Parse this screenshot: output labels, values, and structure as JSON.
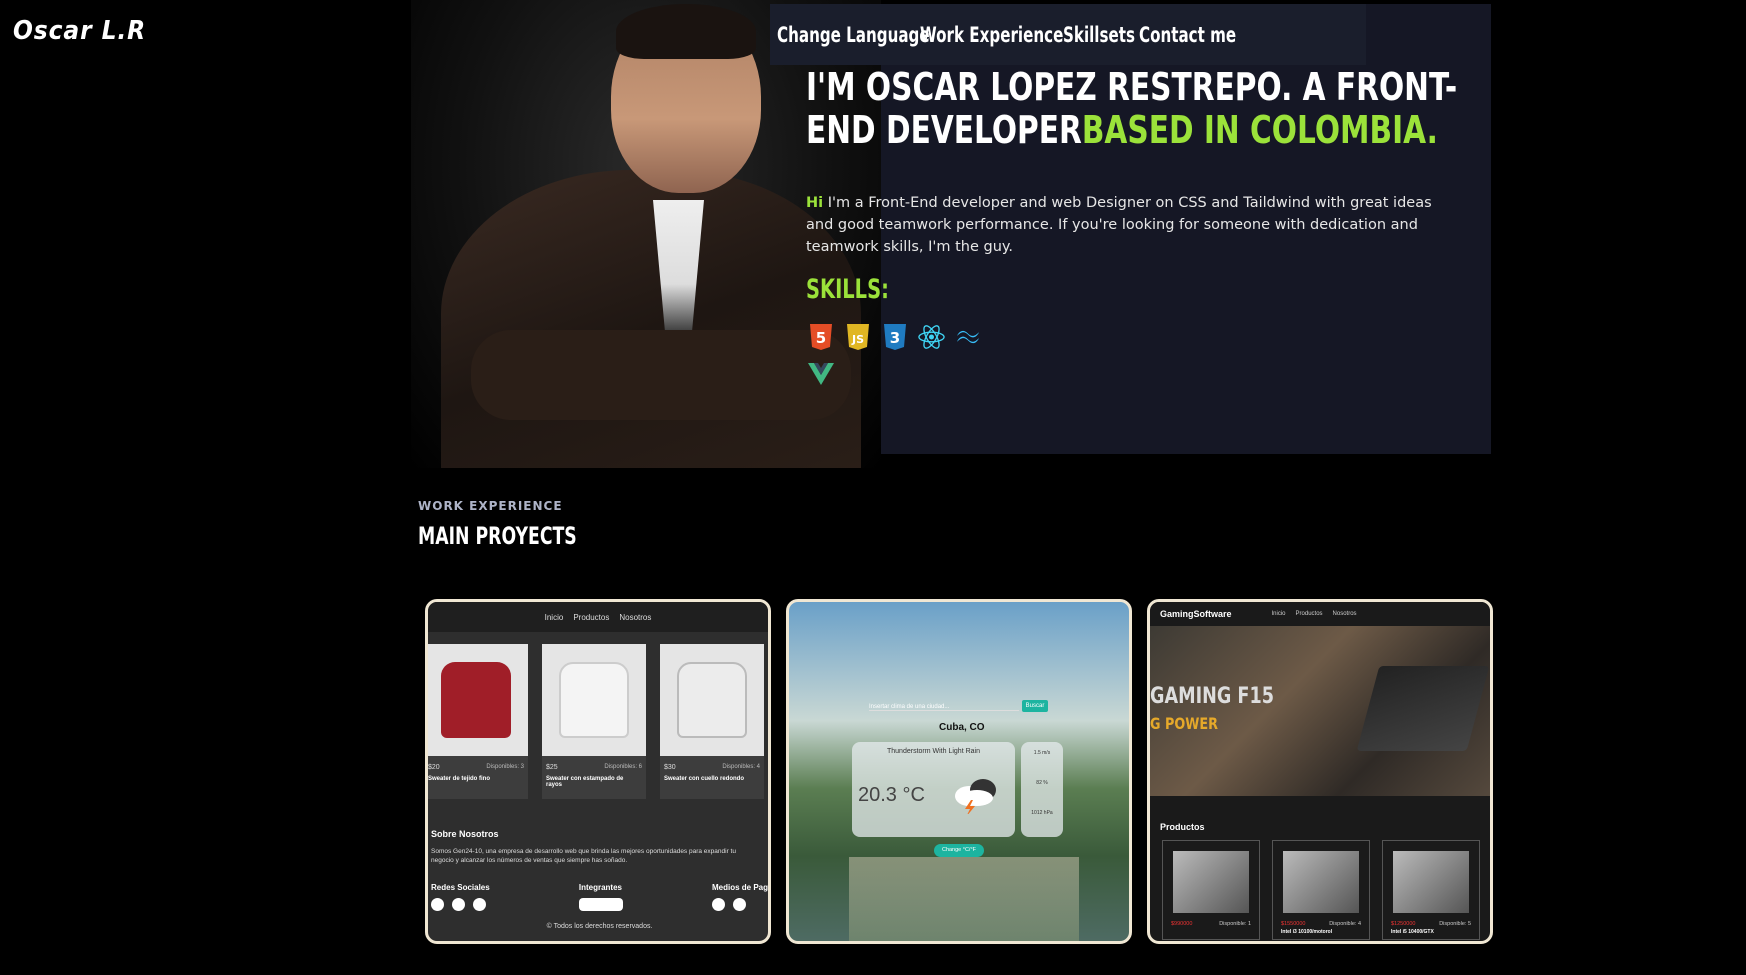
{
  "logo": "Oscar L.R",
  "nav": {
    "items": [
      "Change Language",
      "Work Experience",
      "Skillsets",
      "Contact me"
    ]
  },
  "hero": {
    "headline_white": "I'M OSCAR LOPEZ RESTREPO. A FRONT-END DEVELOPER",
    "headline_green": "BASED IN COLOMBIA.",
    "intro_hi": "Hi",
    "intro_text": " I'm a Front-End developer and web Designer on CSS and Taildwind with great ideas and good teamwork performance. If you're looking for someone with dedication and teamwork skills, I'm the guy.",
    "skills_title": "SKILLS:",
    "skill_icons": [
      "html5-icon",
      "javascript-icon",
      "css3-icon",
      "react-icon",
      "tailwind-icon",
      "vue-icon"
    ]
  },
  "work": {
    "label": "WORK EXPERIENCE",
    "title": "MAIN PROYECTS"
  },
  "projects": {
    "store": {
      "nav": [
        "Inicio",
        "Productos",
        "Nosotros"
      ],
      "products": [
        {
          "price": "$20",
          "stock": "Disponibles: 3",
          "name": "Sweater de tejido fino",
          "color": "#a01e28"
        },
        {
          "price": "$25",
          "stock": "Disponibles: 6",
          "name": "Sweater con estampado de rayos",
          "color": "#e8e8e8"
        },
        {
          "price": "$30",
          "stock": "Disponibles: 4",
          "name": "Sweater con cuello redondo",
          "color": "#d8d8d8"
        }
      ],
      "about_title": "Sobre Nosotros",
      "about_text": "Somos Gen24-10, una empresa de desarrollo web que brinda las mejores oportunidades para expandir tu negocio y alcanzar los números de ventas que siempre has soñado.",
      "footer_cols": [
        "Redes Sociales",
        "Integrantes",
        "Medios de Pag"
      ],
      "rights": "© Todos los derechos reservados."
    },
    "weather": {
      "placeholder": "Insertar clima de una ciudad...",
      "button": "Buscar",
      "city": "Cuba, CO",
      "condition": "Thunderstorm With Light Rain",
      "temp": "20.3 °C",
      "side": [
        "1.5 m/s",
        "82 %",
        "1012 hPa"
      ],
      "change": "Change °C/°F"
    },
    "gaming": {
      "brand": "GamingSoftware",
      "nav": [
        "Inicio",
        "Productos",
        "Nosotros"
      ],
      "banner1": "GAMING F15",
      "banner2": "G POWER",
      "products_title": "Productos",
      "products": [
        {
          "price": "$990000",
          "stock": "Disponible: 1",
          "name": ""
        },
        {
          "price": "$1550000",
          "stock": "Disponible: 4",
          "name": "Intel i3 10100/motorol"
        },
        {
          "price": "$1250000",
          "stock": "Disponible: 5",
          "name": "Intel i5 10400/GTX"
        }
      ]
    }
  },
  "colors": {
    "accent": "#9be23a",
    "panel": "#151725",
    "teal": "#1db4a0"
  }
}
